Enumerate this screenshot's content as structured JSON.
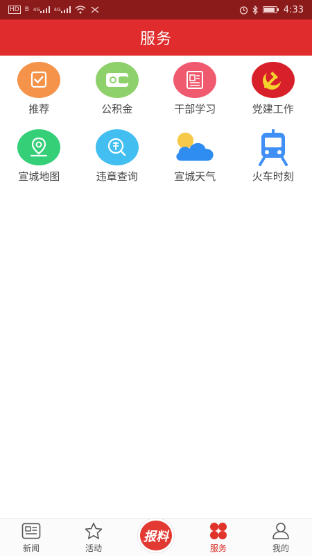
{
  "status_bar": {
    "left_tags": [
      "HD",
      "B",
      "4G",
      "4G"
    ],
    "time": "4:33"
  },
  "header": {
    "title": "服务"
  },
  "services": [
    {
      "label": "推荐",
      "icon": "check-frame-icon",
      "color": "#f5934a"
    },
    {
      "label": "公积金",
      "icon": "wallet-icon",
      "color": "#8ed06a"
    },
    {
      "label": "干部学习",
      "icon": "document-icon",
      "color": "#ef5a6e"
    },
    {
      "label": "党建工作",
      "icon": "hammer-sickle-icon",
      "color": "#d8202a"
    },
    {
      "label": "宣城地图",
      "icon": "map-pin-icon",
      "color": "#35cf78"
    },
    {
      "label": "违章查询",
      "icon": "violation-search-icon",
      "color": "#42bff0"
    },
    {
      "label": "宣城天气",
      "icon": "weather-cloud-sun-icon",
      "color": "#2f8cf0"
    },
    {
      "label": "火车时刻",
      "icon": "train-icon",
      "color": "#3f8ff5"
    }
  ],
  "tabbar": {
    "items": [
      {
        "label": "新闻",
        "icon": "newspaper-icon"
      },
      {
        "label": "活动",
        "icon": "star-icon"
      },
      {
        "label": "报料",
        "icon": "report-button"
      },
      {
        "label": "服务",
        "icon": "clover-icon",
        "active": true
      },
      {
        "label": "我的",
        "icon": "user-icon"
      }
    ]
  }
}
